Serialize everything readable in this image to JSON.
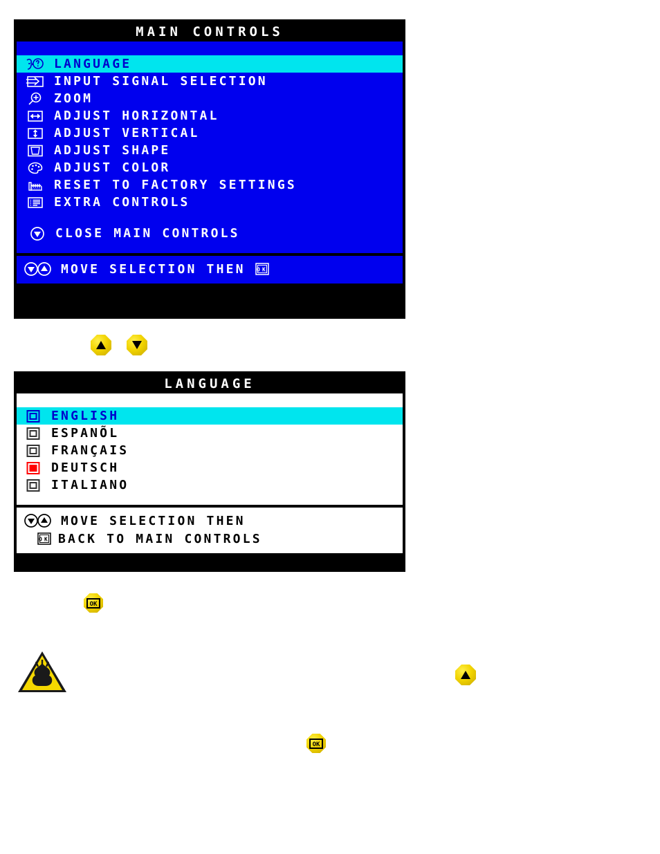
{
  "main_controls": {
    "title": "MAIN CONTROLS",
    "items": [
      {
        "label": "LANGUAGE",
        "icon": "language-face-question-icon",
        "selected": true
      },
      {
        "label": "INPUT SIGNAL SELECTION",
        "icon": "input-signal-arrow-icon",
        "selected": false
      },
      {
        "label": "ZOOM",
        "icon": "zoom-magnifier-plus-icon",
        "selected": false
      },
      {
        "label": "ADJUST HORIZONTAL",
        "icon": "adjust-horizontal-arrows-icon",
        "selected": false
      },
      {
        "label": "ADJUST VERTICAL",
        "icon": "adjust-vertical-arrows-icon",
        "selected": false
      },
      {
        "label": "ADJUST SHAPE",
        "icon": "adjust-shape-trapezoid-icon",
        "selected": false
      },
      {
        "label": "ADJUST COLOR",
        "icon": "adjust-color-palette-icon",
        "selected": false
      },
      {
        "label": "RESET TO FACTORY SETTINGS",
        "icon": "factory-reset-icon",
        "selected": false
      },
      {
        "label": "EXTRA CONTROLS",
        "icon": "extra-controls-list-icon",
        "selected": false
      }
    ],
    "close_item": {
      "label": "CLOSE MAIN CONTROLS",
      "icon": "down-arrow-circle-icon"
    },
    "footer": {
      "label": "MOVE SELECTION THEN",
      "lead_icons": "down-up-arrow-circles-icon",
      "trail_icon": "ok-button-icon"
    }
  },
  "language_menu": {
    "title": "LANGUAGE",
    "items": [
      {
        "label": "ENGLISH",
        "selected": true,
        "active": false
      },
      {
        "label": "ESPANÕL",
        "selected": false,
        "active": false
      },
      {
        "label": "FRANÇAIS",
        "selected": false,
        "active": false
      },
      {
        "label": "DEUTSCH",
        "selected": false,
        "active": true
      },
      {
        "label": "ITALIANO",
        "selected": false,
        "active": false
      }
    ],
    "footer": {
      "line1": "MOVE SELECTION THEN",
      "line1_icons": "down-up-arrow-circles-icon",
      "line2": "BACK TO MAIN CONTROLS",
      "line2_icon": "ok-button-icon"
    }
  },
  "buttons": {
    "up_1": "up-arrow-button",
    "down_1": "down-arrow-button",
    "ok_1": "ok-button",
    "up_2": "up-arrow-button",
    "ok_2": "ok-button",
    "warning": "warning-triangle-icon"
  },
  "colors": {
    "osd_blue": "#0000ee",
    "osd_highlight": "#00e5ee",
    "osd_border": "#000000",
    "osd_text": "#ffffff",
    "highlight_text": "#0000cc",
    "active_marker_red": "#ff0000",
    "button_yellow": "#f2d400"
  }
}
